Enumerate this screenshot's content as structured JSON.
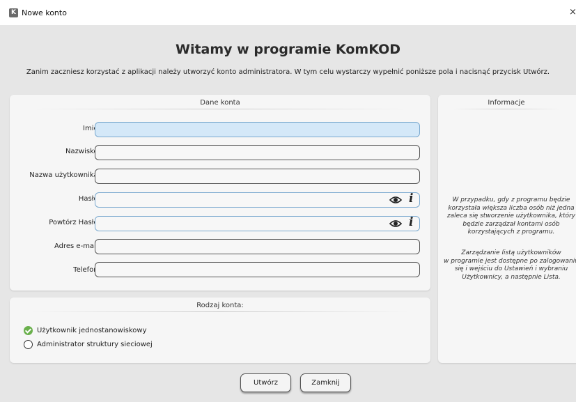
{
  "window": {
    "app_icon_letter": "K",
    "title": "Nowe konto",
    "close_glyph": "×"
  },
  "header": {
    "title": "Witamy w programie KomKOD",
    "subtitle": "Zanim zaczniesz korzystać z aplikacji należy utworzyć konto administratora. W tym celu wystarczy wypełnić poniższe pola i nacisnąć przycisk Utwórz."
  },
  "account_panel": {
    "title": "Dane konta",
    "fields": [
      {
        "label": "Imię:",
        "value": ""
      },
      {
        "label": "Nazwisko:",
        "value": ""
      },
      {
        "label": "Nazwa użytkownika:",
        "value": ""
      },
      {
        "label": "Hasło:",
        "value": ""
      },
      {
        "label": "Powtórz Hasło:",
        "value": ""
      },
      {
        "label": "Adres e-mail:",
        "value": ""
      },
      {
        "label": "Telefon:",
        "value": ""
      }
    ],
    "info_glyph": "i"
  },
  "info_panel": {
    "title": "Informacje",
    "paragraph1": [
      "W przypadku, gdy z programu będzie",
      "korzystała większa liczba osób niż jedna",
      "zaleca się stworzenie użytkownika, który",
      "będzie zarządzał kontami osób",
      "korzystających z programu."
    ],
    "paragraph2": [
      "Zarządzanie listą użytkowników",
      "w programie jest dostępne po zalogowaniu",
      "się i wejściu do Ustawień i wybraniu",
      "Użytkownicy, a następnie Lista."
    ]
  },
  "account_type_panel": {
    "title": "Rodzaj konta:",
    "options": [
      {
        "label": "Użytkownik jednostanowiskowy",
        "selected": true
      },
      {
        "label": "Administrator struktury sieciowej",
        "selected": false
      }
    ]
  },
  "buttons": {
    "create": "Utwórz",
    "close": "Zamknij"
  },
  "colors": {
    "active_field": "#d4e8f8",
    "selected_radio": "#6ab04c"
  }
}
